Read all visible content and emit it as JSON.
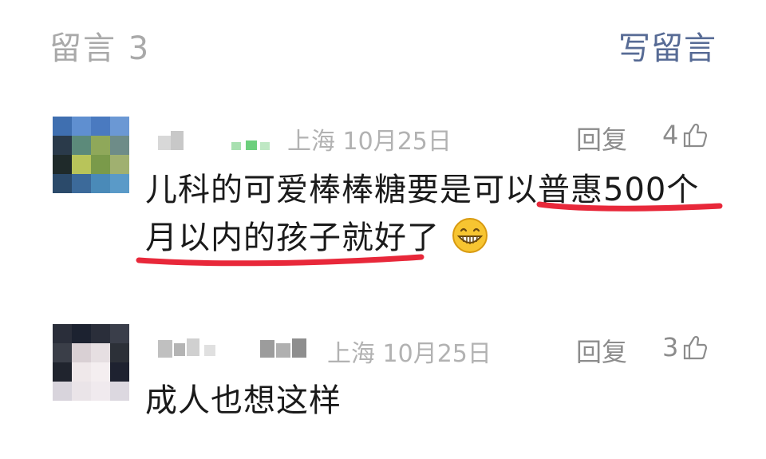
{
  "header": {
    "comment_count_label": "留言 3",
    "write_label": "写留言"
  },
  "comments": [
    {
      "location_date": "上海 10月25日",
      "reply_label": "回复",
      "like_count": "4",
      "text_line1": "儿科的可爱棒棒糖要是可以普惠500个",
      "text_line2": "月以内的孩子就好了",
      "emoji_icon": "grinning-face-icon"
    },
    {
      "location_date": "上海 10月25日",
      "reply_label": "回复",
      "like_count": "3",
      "text_line1": "成人也想这样"
    }
  ],
  "colors": {
    "accent_link": "#576b95",
    "muted_text": "#b2b2b2",
    "annotation_red": "#e8283a"
  }
}
